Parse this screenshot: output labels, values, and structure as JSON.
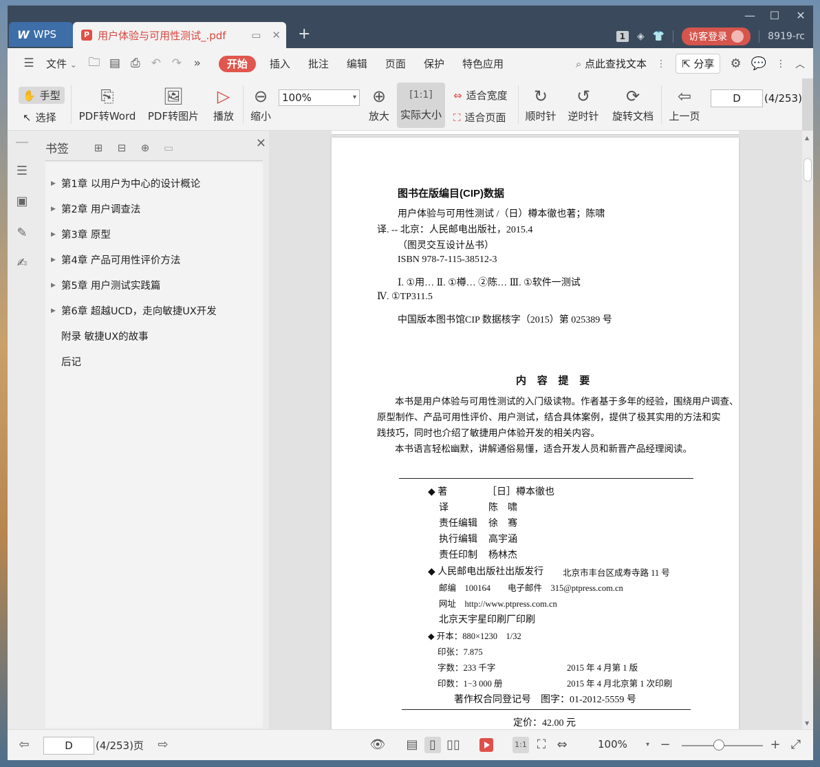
{
  "titlebar": {
    "wps_tab": "WPS",
    "doc_tab": "用户体验与可用性测试_.pdf",
    "page_count_badge": "1",
    "login": "访客登录",
    "user_id": "8919-rc"
  },
  "menubar": {
    "file": "文件",
    "tabs": [
      "开始",
      "插入",
      "批注",
      "编辑",
      "页面",
      "保护",
      "特色应用"
    ],
    "search": "点此查找文本",
    "share": "分享"
  },
  "toolbar": {
    "hand": "手型",
    "select": "选择",
    "pdf_to_word": "PDF转Word",
    "pdf_to_image": "PDF转图片",
    "play": "播放",
    "zoom_out": "缩小",
    "zoom_value": "100%",
    "zoom_in": "放大",
    "actual_size": "实际大小",
    "fit_width": "适合宽度",
    "fit_page": "适合页面",
    "clockwise": "顺时针",
    "counter_clockwise": "逆时针",
    "rotate_doc": "旋转文档",
    "prev_page": "上一页",
    "page_input": "D",
    "page_total": "(4/253)"
  },
  "bookmarks": {
    "title": "书签",
    "items": [
      {
        "label": "第1章  以用户为中心的设计概论",
        "expandable": true
      },
      {
        "label": "第2章  用户调查法",
        "expandable": true
      },
      {
        "label": "第3章  原型",
        "expandable": true
      },
      {
        "label": "第4章  产品可用性评价方法",
        "expandable": true
      },
      {
        "label": "第5章  用户测试实践篇",
        "expandable": true
      },
      {
        "label": "第6章  超越UCD，走向敏捷UX开发",
        "expandable": true
      },
      {
        "label": "附录  敏捷UX的故事",
        "expandable": false
      },
      {
        "label": "后记",
        "expandable": false
      }
    ]
  },
  "page": {
    "cip_title": "图书在版编目(CIP)数据",
    "cip_lines": [
      "用户体验与可用性测试 /（日）樽本徹也著；陈啸",
      "译. -- 北京：人民邮电出版社，2015.4",
      "（图灵交互设计丛书）",
      "ISBN 978-7-115-38512-3",
      "Ⅰ. ①用… Ⅱ. ①樽… ②陈… Ⅲ. ①软件一测试",
      "Ⅳ. ①TP311.5",
      "中国版本图书馆CIP 数据核字（2015）第 025389 号"
    ],
    "summary_title": "内 容 提 要",
    "summary_lines": [
      "本书是用户体验与可用性测试的入门级读物。作者基于多年的经验，围绕用户调查、",
      "原型制作、产品可用性评价、用户测试，结合具体案例，提供了极其实用的方法和实",
      "践技巧，同时也介绍了敏捷用户体验开发的相关内容。",
      "本书语言轻松幽默，讲解通俗易懂，适合开发人员和新晋产品经理阅读。"
    ],
    "credits": [
      {
        "role": "◆ 著",
        "name": "［日］樽本徹也"
      },
      {
        "role": "译",
        "name": "陈　啸"
      },
      {
        "role": "责任编辑",
        "name": "徐　骞"
      },
      {
        "role": "执行编辑",
        "name": "高宇涵"
      },
      {
        "role": "责任印制",
        "name": "杨林杰"
      }
    ],
    "publisher": "◆ 人民邮电出版社出版发行",
    "address": "北京市丰台区成寿寺路 11 号",
    "postcode": "邮编　100164",
    "email": "电子邮件　315@ptpress.com.cn",
    "website": "网址　http://www.ptpress.com.cn",
    "printer": "北京天宇星印刷厂印刷",
    "format": "◆ 开本：880×1230　1/32",
    "sheets": "印张：7.875",
    "words": "字数：233 千字",
    "edition": "2015 年 4 月第 1 版",
    "copies": "印数：1−3 000 册",
    "printing": "2015 年 4 月北京第 1 次印刷",
    "copyright": "著作权合同登记号　图字：01-2012-5559 号",
    "price": "定价：42.00 元"
  },
  "statusbar": {
    "page_input": "D",
    "page_total": "(4/253)页",
    "zoom": "100%"
  },
  "colors": {
    "accent": "#e0574d",
    "titlebar": "#3a4a5c",
    "wps_tab": "#3d6ea8"
  }
}
